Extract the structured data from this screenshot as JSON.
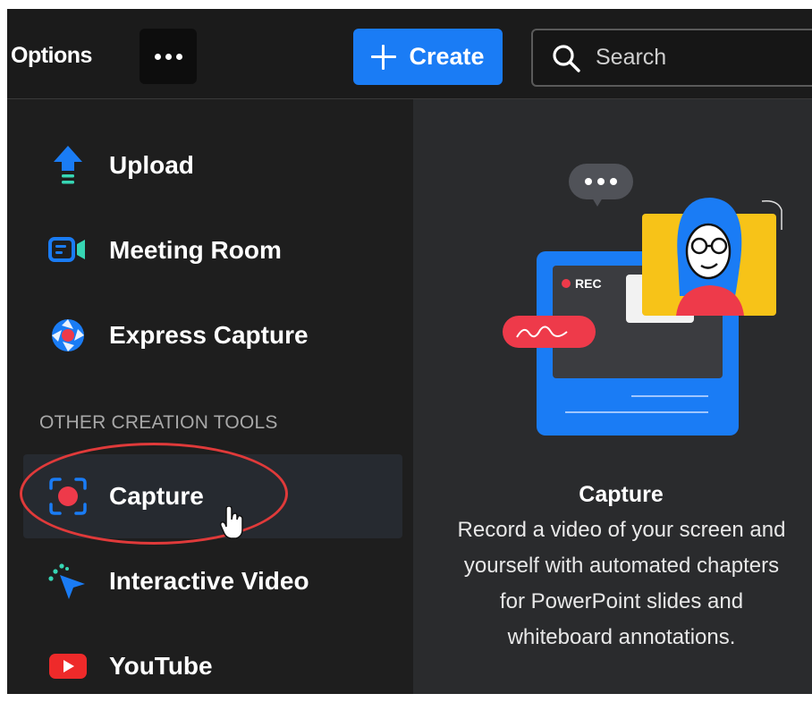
{
  "header": {
    "options_label": "Options",
    "create_label": "Create",
    "search_placeholder": "Search"
  },
  "menu": {
    "items": [
      {
        "label": "Upload",
        "icon": "upload-icon"
      },
      {
        "label": "Meeting Room",
        "icon": "meeting-room-icon"
      },
      {
        "label": "Express Capture",
        "icon": "express-capture-icon"
      }
    ],
    "section_header": "OTHER CREATION TOOLS",
    "other_items": [
      {
        "label": "Capture",
        "icon": "capture-icon",
        "active": true
      },
      {
        "label": "Interactive Video",
        "icon": "interactive-video-icon"
      },
      {
        "label": "YouTube",
        "icon": "youtube-icon"
      }
    ]
  },
  "preview": {
    "rec_label": "REC",
    "title": "Capture",
    "description": "Record a video of your screen and yourself with automated chapters for PowerPoint slides and whiteboard annotations."
  },
  "colors": {
    "accent_blue": "#1a7cf5",
    "record_red": "#ee3a4a",
    "highlight_red": "#e03a3a",
    "teal": "#37d6b4",
    "yellow": "#f7c318"
  }
}
